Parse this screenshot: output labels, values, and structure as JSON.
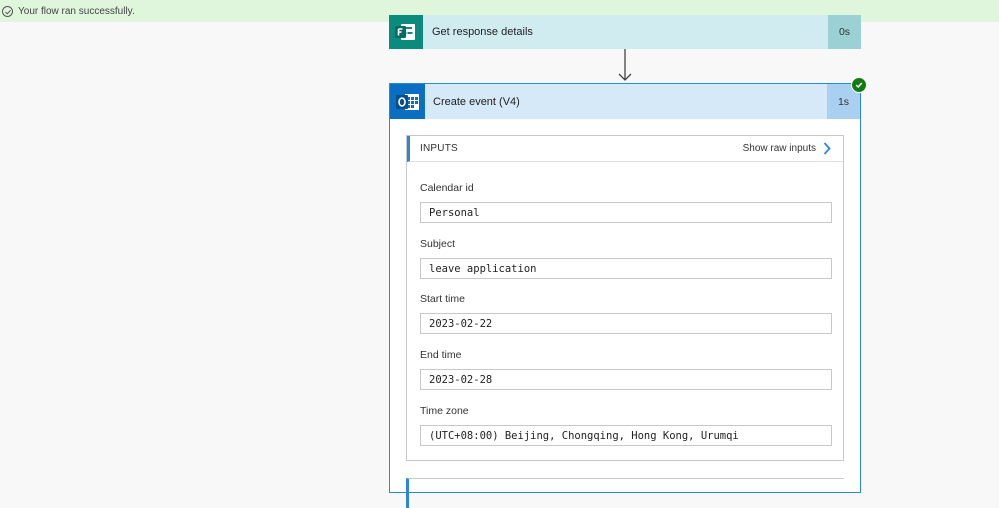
{
  "banner": {
    "message": "Your flow ran successfully.",
    "status_color": "#dff6dd"
  },
  "prev_step": {
    "title": "Get response details",
    "duration": "0s",
    "icon": "forms-icon"
  },
  "step": {
    "title": "Create event (V4)",
    "duration": "1s",
    "icon": "outlook-icon",
    "status": "success",
    "inputs": {
      "header": "INPUTS",
      "raw_link": "Show raw inputs",
      "fields": [
        {
          "label": "Calendar id",
          "value": "Personal"
        },
        {
          "label": "Subject",
          "value": "leave application"
        },
        {
          "label": "Start time",
          "value": "2023-02-22"
        },
        {
          "label": "End time",
          "value": "2023-02-28"
        },
        {
          "label": "Time zone",
          "value": "(UTC+08:00) Beijing, Chongqing, Hong Kong, Urumqi"
        }
      ]
    }
  },
  "colors": {
    "accent": "#2b88d8",
    "success": "#107c10",
    "forms": "#0b8a7e",
    "outlook": "#0a6fc2"
  }
}
